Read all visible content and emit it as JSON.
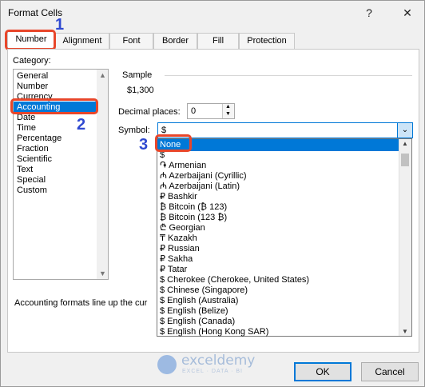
{
  "window": {
    "title": "Format Cells",
    "help": "?",
    "close": "✕"
  },
  "tabs": [
    {
      "label": "Number"
    },
    {
      "label": "Alignment"
    },
    {
      "label": "Font"
    },
    {
      "label": "Border"
    },
    {
      "label": "Fill"
    },
    {
      "label": "Protection"
    }
  ],
  "category": {
    "label": "Category:",
    "items": [
      "General",
      "Number",
      "Currency",
      "Accounting",
      "Date",
      "Time",
      "Percentage",
      "Fraction",
      "Scientific",
      "Text",
      "Special",
      "Custom"
    ],
    "selected": "Accounting"
  },
  "sample": {
    "label": "Sample",
    "value": "$1,300"
  },
  "decimal": {
    "label": "Decimal places:",
    "value": "0"
  },
  "symbol": {
    "label": "Symbol:",
    "value": "$",
    "options": [
      "None",
      "$",
      "֏ Armenian",
      "₼ Azerbaijani (Cyrillic)",
      "₼ Azerbaijani (Latin)",
      "₽ Bashkir",
      "₿ Bitcoin (₿ 123)",
      "₿ Bitcoin (123 ₿)",
      "₾ Georgian",
      "₸ Kazakh",
      "₽ Russian",
      "₽ Sakha",
      "₽ Tatar",
      "$ Cherokee (Cherokee, United States)",
      "$ Chinese (Singapore)",
      "$ English (Australia)",
      "$ English (Belize)",
      "$ English (Canada)",
      "$ English (Hong Kong SAR)"
    ],
    "highlighted": "None"
  },
  "description": "Accounting formats line up the cur",
  "watermark": {
    "brand": "exceldemy",
    "tagline": "EXCEL · DATA · BI"
  },
  "buttons": {
    "ok": "OK",
    "cancel": "Cancel"
  },
  "annotations": [
    "1",
    "2",
    "3"
  ],
  "colors": {
    "annotation": "#2f49d1",
    "highlight_box": "#e8462a",
    "selection": "#0078d7"
  }
}
